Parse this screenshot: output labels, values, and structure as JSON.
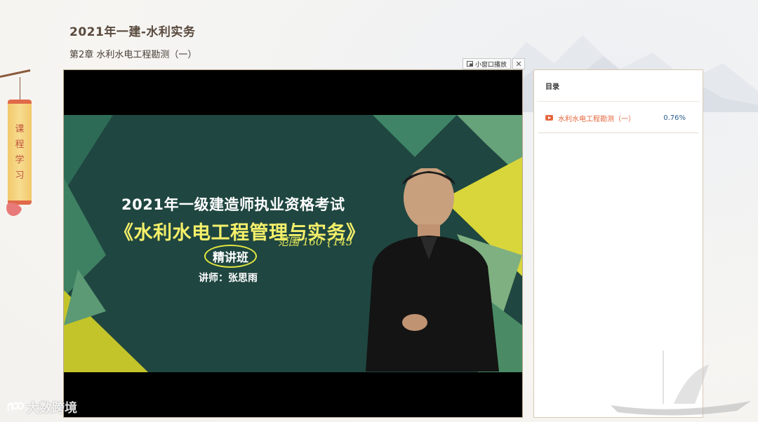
{
  "course": {
    "title": "2021年一建-水利实务",
    "chapter": "第2章 水利水电工程勘测（一）"
  },
  "side_tab": {
    "chars": [
      "课",
      "程",
      "学",
      "习"
    ]
  },
  "player": {
    "mini_window_label": "小窗口播放",
    "close_symbol": "✕",
    "slide": {
      "title_line1": "2021年一级建造师执业资格考试",
      "title_line2": "《水利水电工程管理与实务》",
      "class_name": "精讲班",
      "teacher": "讲师：张思雨",
      "handwriting": "范围 160 {145"
    }
  },
  "catalog": {
    "header": "目录",
    "items": [
      {
        "label": "水利水电工程勘测（一）",
        "progress": "0.76%"
      }
    ]
  },
  "watermark": {
    "text": "大数跨境"
  },
  "colors": {
    "accent_orange": "#e5673e",
    "progress_blue": "#2a5f8f",
    "title_brown": "#5a4a3e"
  }
}
